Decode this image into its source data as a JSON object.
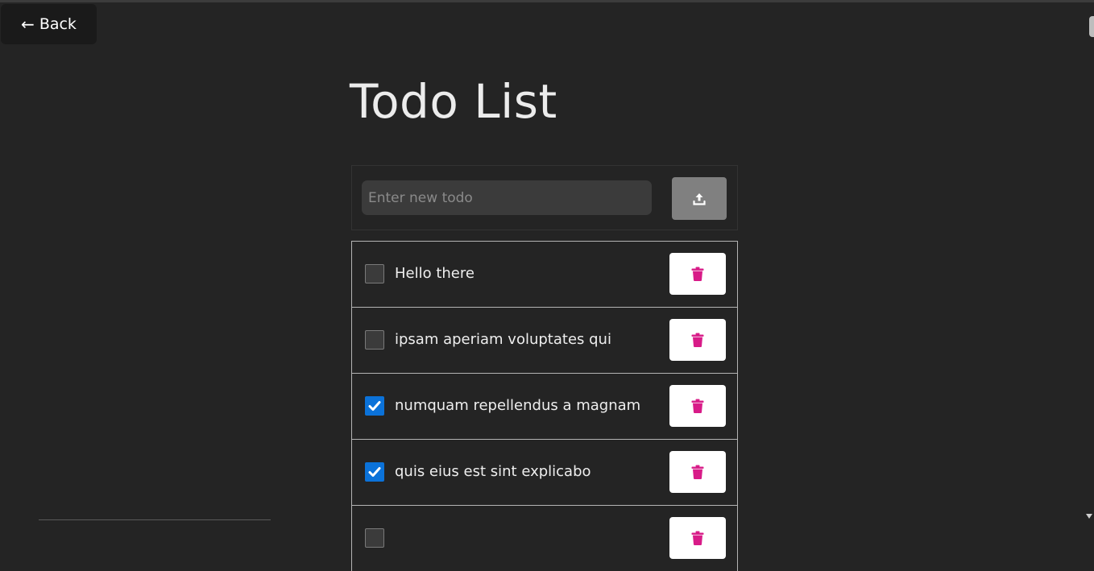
{
  "back_button": {
    "arrow": "←",
    "label": "Back"
  },
  "title": "Todo List",
  "new_todo": {
    "placeholder": "Enter new todo",
    "value": "",
    "submit_icon": "upload-icon"
  },
  "todos": [
    {
      "text": "Hello there",
      "completed": false
    },
    {
      "text": "ipsam aperiam voluptates qui",
      "completed": false
    },
    {
      "text": "numquam repellendus a magnam",
      "completed": true
    },
    {
      "text": "quis eius est sint explicabo",
      "completed": true
    },
    {
      "text": "",
      "completed": false
    }
  ],
  "colors": {
    "background": "#242424",
    "checkbox_checked": "#0b72d9",
    "delete_icon": "#d81b88",
    "submit_button": "#808080"
  }
}
